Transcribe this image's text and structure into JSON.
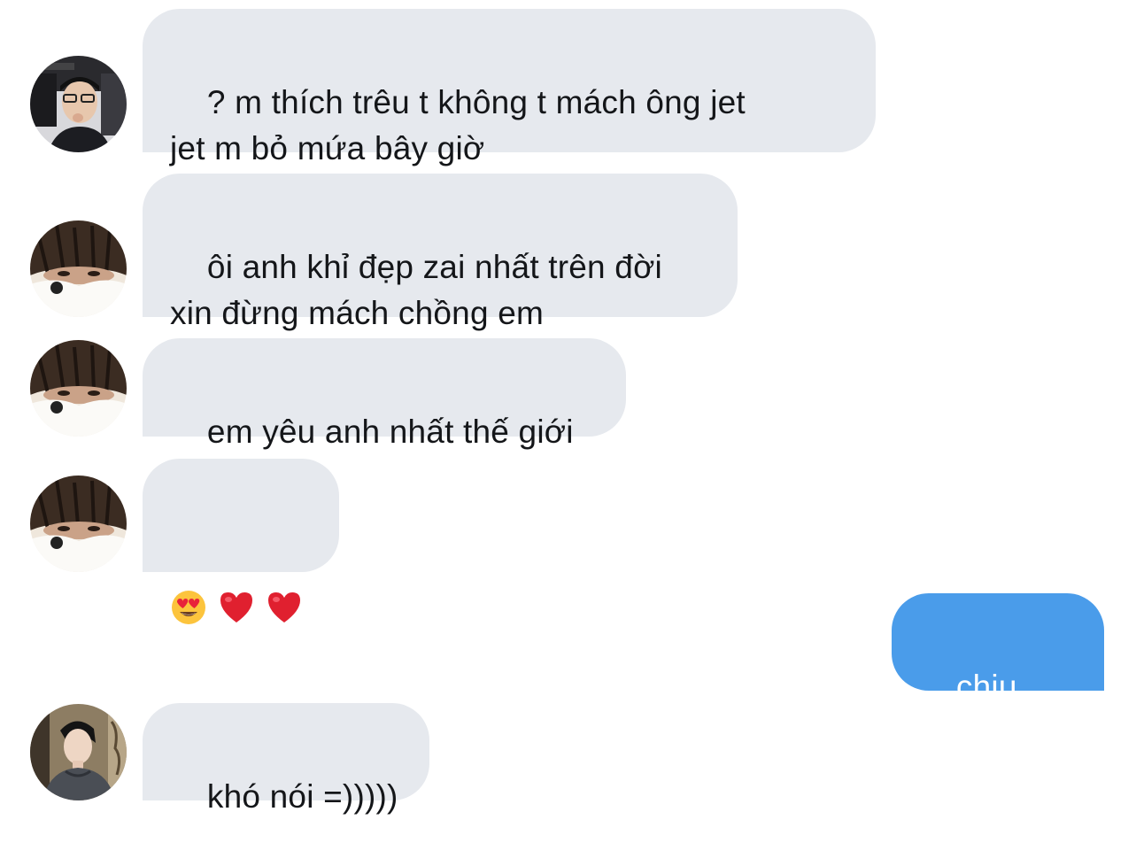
{
  "messages": [
    {
      "direction": "incoming",
      "avatar": "avatar-boy-glasses",
      "text": "? m thích trêu t không t mách ông jet\njet m bỏ mứa bây giờ"
    },
    {
      "direction": "incoming",
      "avatar": "avatar-hair-cover",
      "text": "ôi anh khỉ đẹp zai nhất trên đời\nxin đừng mách chồng em"
    },
    {
      "direction": "incoming",
      "avatar": "avatar-hair-cover",
      "text": "em yêu anh nhất thế giới"
    },
    {
      "direction": "incoming",
      "avatar": "avatar-hair-cover",
      "emojis": [
        "heart-eyes-emoji",
        "red-heart-emoji",
        "red-heart-emoji"
      ]
    },
    {
      "direction": "outgoing",
      "text": "chịu luôn"
    },
    {
      "direction": "incoming",
      "avatar": "avatar-man-sweater",
      "text": "khó nói =)))))"
    }
  ],
  "colors": {
    "incoming_bubble": "#e6e9ee",
    "outgoing_bubble": "#4a9cea",
    "incoming_text": "#141619",
    "outgoing_text": "#ffffff"
  }
}
